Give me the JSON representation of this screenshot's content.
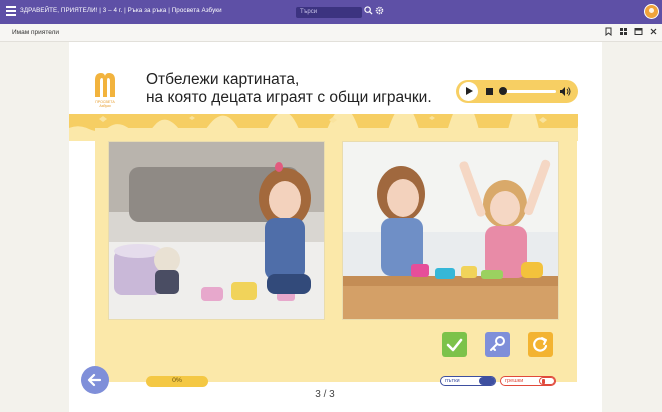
{
  "topbar": {
    "breadcrumb": "ЗДРАВЕЙТЕ, ПРИЯТЕЛИ! | 3 – 4 г. | Ръка за ръка | Просвета Азбуки",
    "search_placeholder": "Търси"
  },
  "subbar": {
    "user": "Имам приятели"
  },
  "logo": {
    "caption": "ПРОСВЕТА Азбуки"
  },
  "exercise": {
    "instruction_line1": "Отбележи картината,",
    "instruction_line2": "на която децата играят с общи играчки."
  },
  "player": {
    "progress": 0
  },
  "footer": {
    "progress_label": "0%",
    "page_indicator": "3 / 3",
    "hints_label": "пътки",
    "errors_label": "грешки"
  },
  "colors": {
    "topbar": "#5e50a6",
    "accent_yellow": "#f6ce63",
    "content_bg": "#fbe8a9",
    "check_button": "#7cc24a",
    "key_button": "#7f8fd9",
    "reset_button": "#f3b331",
    "error_red": "#e0493b"
  },
  "icons": [
    "menu-icon",
    "search-icon",
    "gear-icon",
    "avatar",
    "bookmark-icon",
    "grid-icon",
    "window-icon",
    "close-icon",
    "play-icon",
    "stop-icon",
    "volume-icon",
    "check-icon",
    "key-icon",
    "refresh-icon",
    "arrow-left-icon"
  ]
}
